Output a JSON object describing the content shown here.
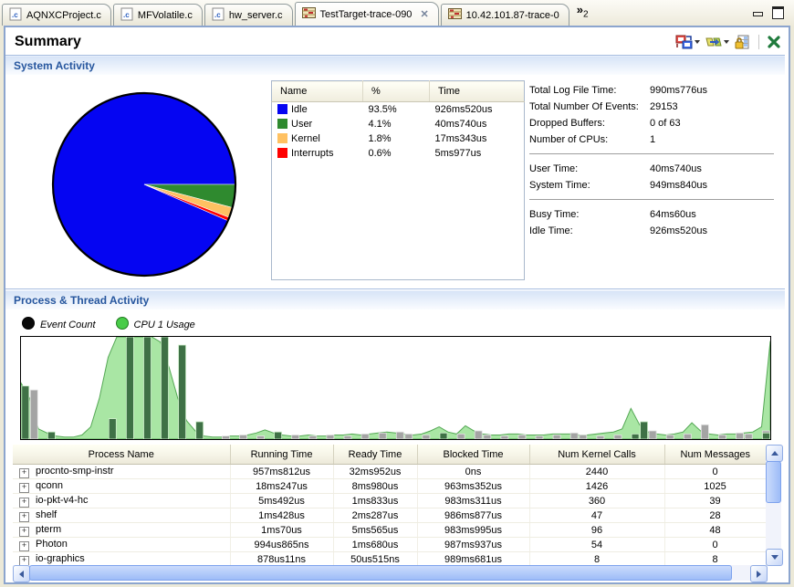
{
  "tabs": [
    {
      "label": "AQNXCProject.c",
      "icon": "c-file-icon",
      "active": false
    },
    {
      "label": "MFVolatile.c",
      "icon": "c-file-icon",
      "active": false
    },
    {
      "label": "hw_server.c",
      "icon": "c-file-icon",
      "active": false
    },
    {
      "label": "TestTarget-trace-090",
      "icon": "trace-icon",
      "active": true,
      "close": "✕"
    },
    {
      "label": "10.42.101.87-trace-0",
      "icon": "trace-icon",
      "active": false
    }
  ],
  "tab_overflow": {
    "chevron": "»",
    "count": "2"
  },
  "editor": {
    "title": "Summary",
    "toolbar_icons": [
      "switch-pane-icon",
      "import-export-icon",
      "lock-columns-icon",
      "close-view-icon"
    ]
  },
  "system_activity": {
    "heading": "System Activity",
    "chart_data": {
      "type": "pie",
      "categories": [
        "Idle",
        "User",
        "Kernel",
        "Interrupts"
      ],
      "values": [
        93.5,
        4.1,
        1.8,
        0.6
      ],
      "colors": [
        "#0505F2",
        "#2F8A2F",
        "#FFC162",
        "#FF0000"
      ],
      "start_angle_deg": 0,
      "direction": "clockwise",
      "draw_order": [
        "User",
        "Kernel",
        "Interrupts",
        "Idle"
      ]
    },
    "table": {
      "columns": [
        "Name",
        "%",
        "Time"
      ],
      "rows": [
        {
          "name": "Idle",
          "color": "#0505F2",
          "pct": "93.5%",
          "time": "926ms520us"
        },
        {
          "name": "User",
          "color": "#2F8A2F",
          "pct": "4.1%",
          "time": "40ms740us"
        },
        {
          "name": "Kernel",
          "color": "#FFC162",
          "pct": "1.8%",
          "time": "17ms343us"
        },
        {
          "name": "Interrupts",
          "color": "#FF0000",
          "pct": "0.6%",
          "time": "5ms977us"
        }
      ]
    },
    "stats": [
      [
        {
          "label": "Total Log File Time:",
          "value": "990ms776us"
        },
        {
          "label": "Total Number Of Events:",
          "value": "29153"
        },
        {
          "label": "Dropped Buffers:",
          "value": "0 of 63"
        },
        {
          "label": "Number of CPUs:",
          "value": "1"
        }
      ],
      [
        {
          "label": "User Time:",
          "value": "40ms740us"
        },
        {
          "label": "System Time:",
          "value": "949ms840us"
        }
      ],
      [
        {
          "label": "Busy Time:",
          "value": "64ms60us"
        },
        {
          "label": "Idle Time:",
          "value": "926ms520us"
        }
      ]
    ]
  },
  "process_activity": {
    "heading": "Process & Thread Activity",
    "legend": [
      {
        "label": "Event Count",
        "color": "#0A0A0A",
        "border": "#000000"
      },
      {
        "label": "CPU 1 Usage",
        "color": "#49CC49",
        "border": "#1F7A1F"
      }
    ],
    "chart_data": {
      "type": "bar+area",
      "x_slots": 87,
      "ylim": [
        0,
        100
      ],
      "series": [
        {
          "name": "CPU 1 Usage",
          "type": "area",
          "fill": "#A9E6A4",
          "stroke": "#55A855",
          "values": [
            55,
            40,
            10,
            6,
            3,
            2,
            2,
            4,
            12,
            40,
            80,
            100,
            100,
            100,
            100,
            100,
            95,
            70,
            40,
            18,
            8,
            3,
            2,
            2,
            3,
            3,
            4,
            6,
            9,
            6,
            4,
            3,
            3,
            4,
            3,
            3,
            4,
            4,
            5,
            4,
            5,
            6,
            7,
            6,
            5,
            4,
            5,
            8,
            12,
            7,
            5,
            13,
            8,
            5,
            4,
            4,
            5,
            5,
            4,
            4,
            4,
            5,
            5,
            5,
            4,
            4,
            5,
            6,
            7,
            10,
            30,
            14,
            7,
            5,
            4,
            5,
            7,
            16,
            8,
            5,
            4,
            5,
            5,
            6,
            7,
            12,
            96
          ]
        },
        {
          "name": "Event Count",
          "type": "bar",
          "gray": "#A4A4A4",
          "dark": "#3F7146",
          "bars": [
            [
              0,
              52,
              "d"
            ],
            [
              1,
              48,
              "g"
            ],
            [
              3,
              7,
              "d"
            ],
            [
              10,
              20,
              "d"
            ],
            [
              12,
              100,
              "d"
            ],
            [
              14,
              100,
              "d"
            ],
            [
              16,
              100,
              "d"
            ],
            [
              18,
              92,
              "d"
            ],
            [
              20,
              17,
              "d"
            ],
            [
              23,
              3,
              "g"
            ],
            [
              25,
              4,
              "g"
            ],
            [
              27,
              3,
              "g"
            ],
            [
              29,
              7,
              "d"
            ],
            [
              31,
              4,
              "g"
            ],
            [
              33,
              3,
              "g"
            ],
            [
              35,
              4,
              "g"
            ],
            [
              37,
              3,
              "g"
            ],
            [
              39,
              5,
              "g"
            ],
            [
              41,
              6,
              "g"
            ],
            [
              43,
              7,
              "g"
            ],
            [
              44,
              5,
              "g"
            ],
            [
              46,
              4,
              "g"
            ],
            [
              48,
              6,
              "d"
            ],
            [
              50,
              5,
              "g"
            ],
            [
              52,
              8,
              "g"
            ],
            [
              53,
              4,
              "g"
            ],
            [
              55,
              3,
              "g"
            ],
            [
              57,
              4,
              "g"
            ],
            [
              59,
              3,
              "g"
            ],
            [
              61,
              4,
              "g"
            ],
            [
              63,
              6,
              "g"
            ],
            [
              64,
              4,
              "g"
            ],
            [
              66,
              3,
              "g"
            ],
            [
              68,
              4,
              "g"
            ],
            [
              70,
              5,
              "d"
            ],
            [
              71,
              17,
              "d"
            ],
            [
              72,
              8,
              "g"
            ],
            [
              74,
              4,
              "g"
            ],
            [
              76,
              5,
              "g"
            ],
            [
              78,
              14,
              "g"
            ],
            [
              80,
              4,
              "g"
            ],
            [
              82,
              6,
              "g"
            ],
            [
              83,
              5,
              "g"
            ],
            [
              85,
              8,
              "g"
            ],
            [
              86,
              6,
              "d"
            ]
          ]
        }
      ]
    },
    "table": {
      "columns": [
        "Process Name",
        "Running Time",
        "Ready Time",
        "Blocked Time",
        "Num Kernel Calls",
        "Num Messages"
      ],
      "rows": [
        {
          "name": "procnto-smp-instr",
          "running": "957ms812us",
          "ready": "32ms952us",
          "blocked": "0ns",
          "kcalls": "2440",
          "msgs": "0"
        },
        {
          "name": "qconn",
          "running": "18ms247us",
          "ready": "8ms980us",
          "blocked": "963ms352us",
          "kcalls": "1426",
          "msgs": "1025"
        },
        {
          "name": "io-pkt-v4-hc",
          "running": "5ms492us",
          "ready": "1ms833us",
          "blocked": "983ms311us",
          "kcalls": "360",
          "msgs": "39"
        },
        {
          "name": "shelf",
          "running": "1ms428us",
          "ready": "2ms287us",
          "blocked": "986ms877us",
          "kcalls": "47",
          "msgs": "28"
        },
        {
          "name": "pterm",
          "running": "1ms70us",
          "ready": "5ms565us",
          "blocked": "983ms995us",
          "kcalls": "96",
          "msgs": "48"
        },
        {
          "name": "Photon",
          "running": "994us865ns",
          "ready": "1ms680us",
          "blocked": "987ms937us",
          "kcalls": "54",
          "msgs": "0"
        },
        {
          "name": "io-graphics",
          "running": "878us11ns",
          "ready": "50us515ns",
          "blocked": "989ms681us",
          "kcalls": "8",
          "msgs": "8"
        }
      ]
    }
  }
}
